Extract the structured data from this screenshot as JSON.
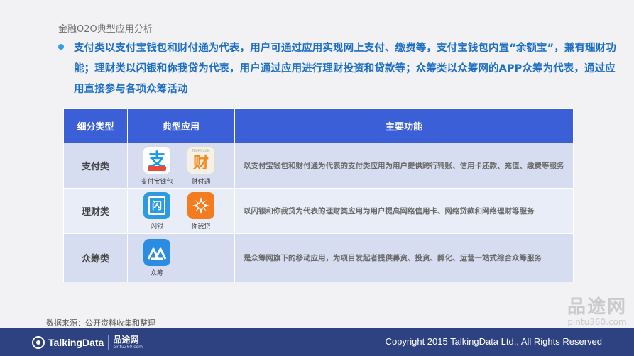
{
  "slide": {
    "title": "金融O2O典型应用分析",
    "bullet": "支付类以支付宝钱包和财付通为代表，用户可通过应用实现网上支付、缴费等，支付宝钱包内置“余额宝”，兼有理财功能；理财类以闪银和你我贷为代表，用户通过应用进行理财投资和贷款等；众筹类以众筹网的APP众筹为代表，通过应用直接参与各项众筹活动"
  },
  "table": {
    "headers": [
      "细分类型",
      "典型应用",
      "主要功能"
    ],
    "rows": [
      {
        "type": "支付类",
        "apps": [
          {
            "label": "支付宝钱包",
            "icon": "alipay-icon",
            "glyph": "支"
          },
          {
            "label": "财付通",
            "icon": "tenpay-icon",
            "glyph": "财",
            "top_text": "TENPAY.COM"
          }
        ],
        "function": "以支付宝钱包和财付通为代表的支付类应用为用户提供跨行转账、信用卡还款、充值、缴费等服务"
      },
      {
        "type": "理财类",
        "apps": [
          {
            "label": "闪银",
            "icon": "shanyin-icon",
            "glyph": "闪"
          },
          {
            "label": "你我贷",
            "icon": "niwodai-icon"
          }
        ],
        "function": "以闪银和你我贷为代表的理财类应用为用户提高网络信用卡、网络贷款和网络理财等服务"
      },
      {
        "type": "众筹类",
        "apps": [
          {
            "label": "众筹",
            "icon": "zhongchou-icon"
          }
        ],
        "function": "是众筹网旗下的移动应用，为项目发起者提供募资、投资、孵化、运营一站式综合众筹服务"
      }
    ]
  },
  "source": "数据来源：公开资料收集和整理",
  "footer": {
    "brand": "TalkingData",
    "brand2_name": "品途网",
    "brand2_domain": "pintu360.com",
    "copyright": "Copyright 2015 TalkingData Ltd., All Rights Reserved"
  },
  "watermark": {
    "name": "品途网",
    "domain": "pintu360.com"
  },
  "colors": {
    "header_blue": "#3b5fd6",
    "bullet_text": "#1e6fc4",
    "footer_bg": "#2e4181"
  }
}
